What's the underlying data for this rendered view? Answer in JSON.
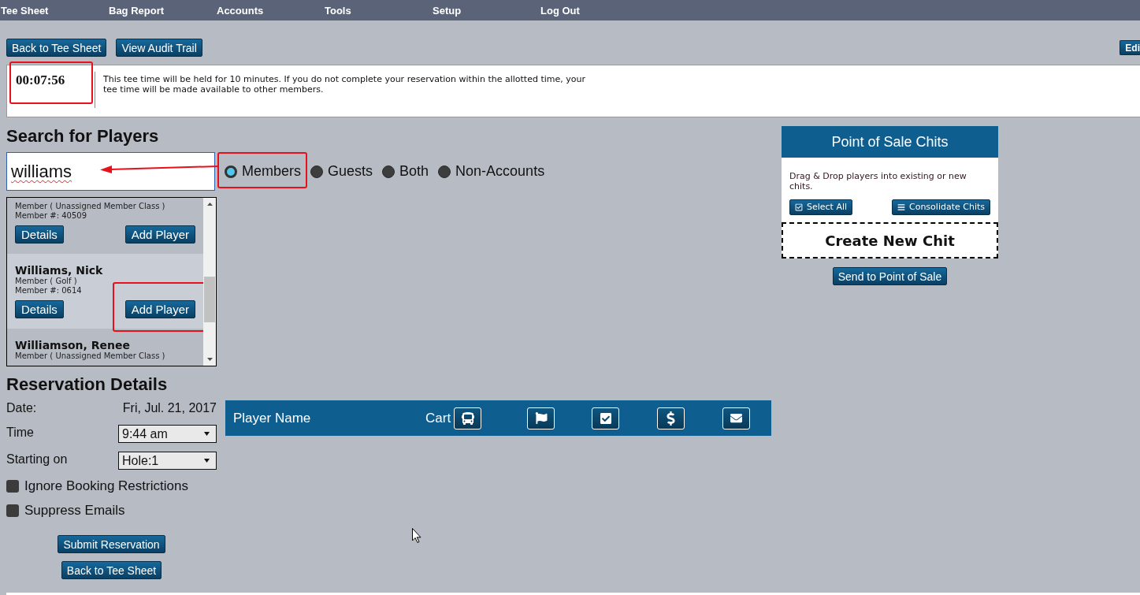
{
  "nav": [
    "Tee Sheet",
    "Bag Report",
    "Accounts",
    "Tools",
    "Setup",
    "Log Out"
  ],
  "toolbar": {
    "buttons": [
      "Back to Tee Sheet",
      "View Audit Trail"
    ],
    "edge_button": "Edi"
  },
  "hold_notice": {
    "timer": "00:07:56",
    "timer_highlighted": true,
    "message": "This tee time will be held for 10 minutes. If you do not complete your reservation within the allotted time, your tee time will be made available to other members."
  },
  "search": {
    "title": "Search for Players",
    "query": "williams",
    "query_spelling_flagged": true,
    "arrow_to_query": true,
    "filters": [
      {
        "label": "Members",
        "selected": true,
        "highlighted": true
      },
      {
        "label": "Guests",
        "selected": false,
        "highlighted": false
      },
      {
        "label": "Both",
        "selected": false,
        "highlighted": false
      },
      {
        "label": "Non-Accounts",
        "selected": false,
        "highlighted": false
      }
    ]
  },
  "results": [
    {
      "selected": false,
      "member_class": "Member ( Unassigned Member Class )",
      "member_number": "Member #: 40509",
      "buttons": [
        {
          "label": "Details",
          "highlighted": false
        },
        {
          "label": "Add Player",
          "highlighted": false
        }
      ]
    },
    {
      "selected": true,
      "name": "Williams, Nick",
      "member_class": "Member ( Golf )",
      "member_number": "Member #: 0614",
      "buttons": [
        {
          "label": "Details",
          "highlighted": false
        },
        {
          "label": "Add Player",
          "highlighted": true
        }
      ]
    },
    {
      "selected": false,
      "name": "Williamson, Renee",
      "member_class": "Member ( Unassigned Member Class )"
    }
  ],
  "reservation": {
    "title": "Reservation Details",
    "fields": [
      {
        "kind": "text",
        "label": "Date:",
        "value": "Fri, Jul. 21, 2017"
      },
      {
        "kind": "select",
        "label": "Time",
        "value": "9:44 am"
      },
      {
        "kind": "select",
        "label": "Starting on",
        "value": "Hole:1"
      }
    ],
    "options": [
      {
        "label": "Ignore Booking Restrictions",
        "checked": false
      },
      {
        "label": "Suppress Emails",
        "checked": false
      }
    ],
    "buttons": [
      "Submit Reservation",
      "Back to Tee Sheet"
    ]
  },
  "players_table": {
    "name_column": "Player Name",
    "cart_column": "Cart"
  },
  "pos_chits": {
    "title": "Point of Sale Chits",
    "hint": "Drag & Drop players into existing or new chits.",
    "buttons": [
      "Select All",
      "Consolidate Chits"
    ],
    "drop_zone": "Create New Chit",
    "send_button": "Send to Point of Sale"
  }
}
